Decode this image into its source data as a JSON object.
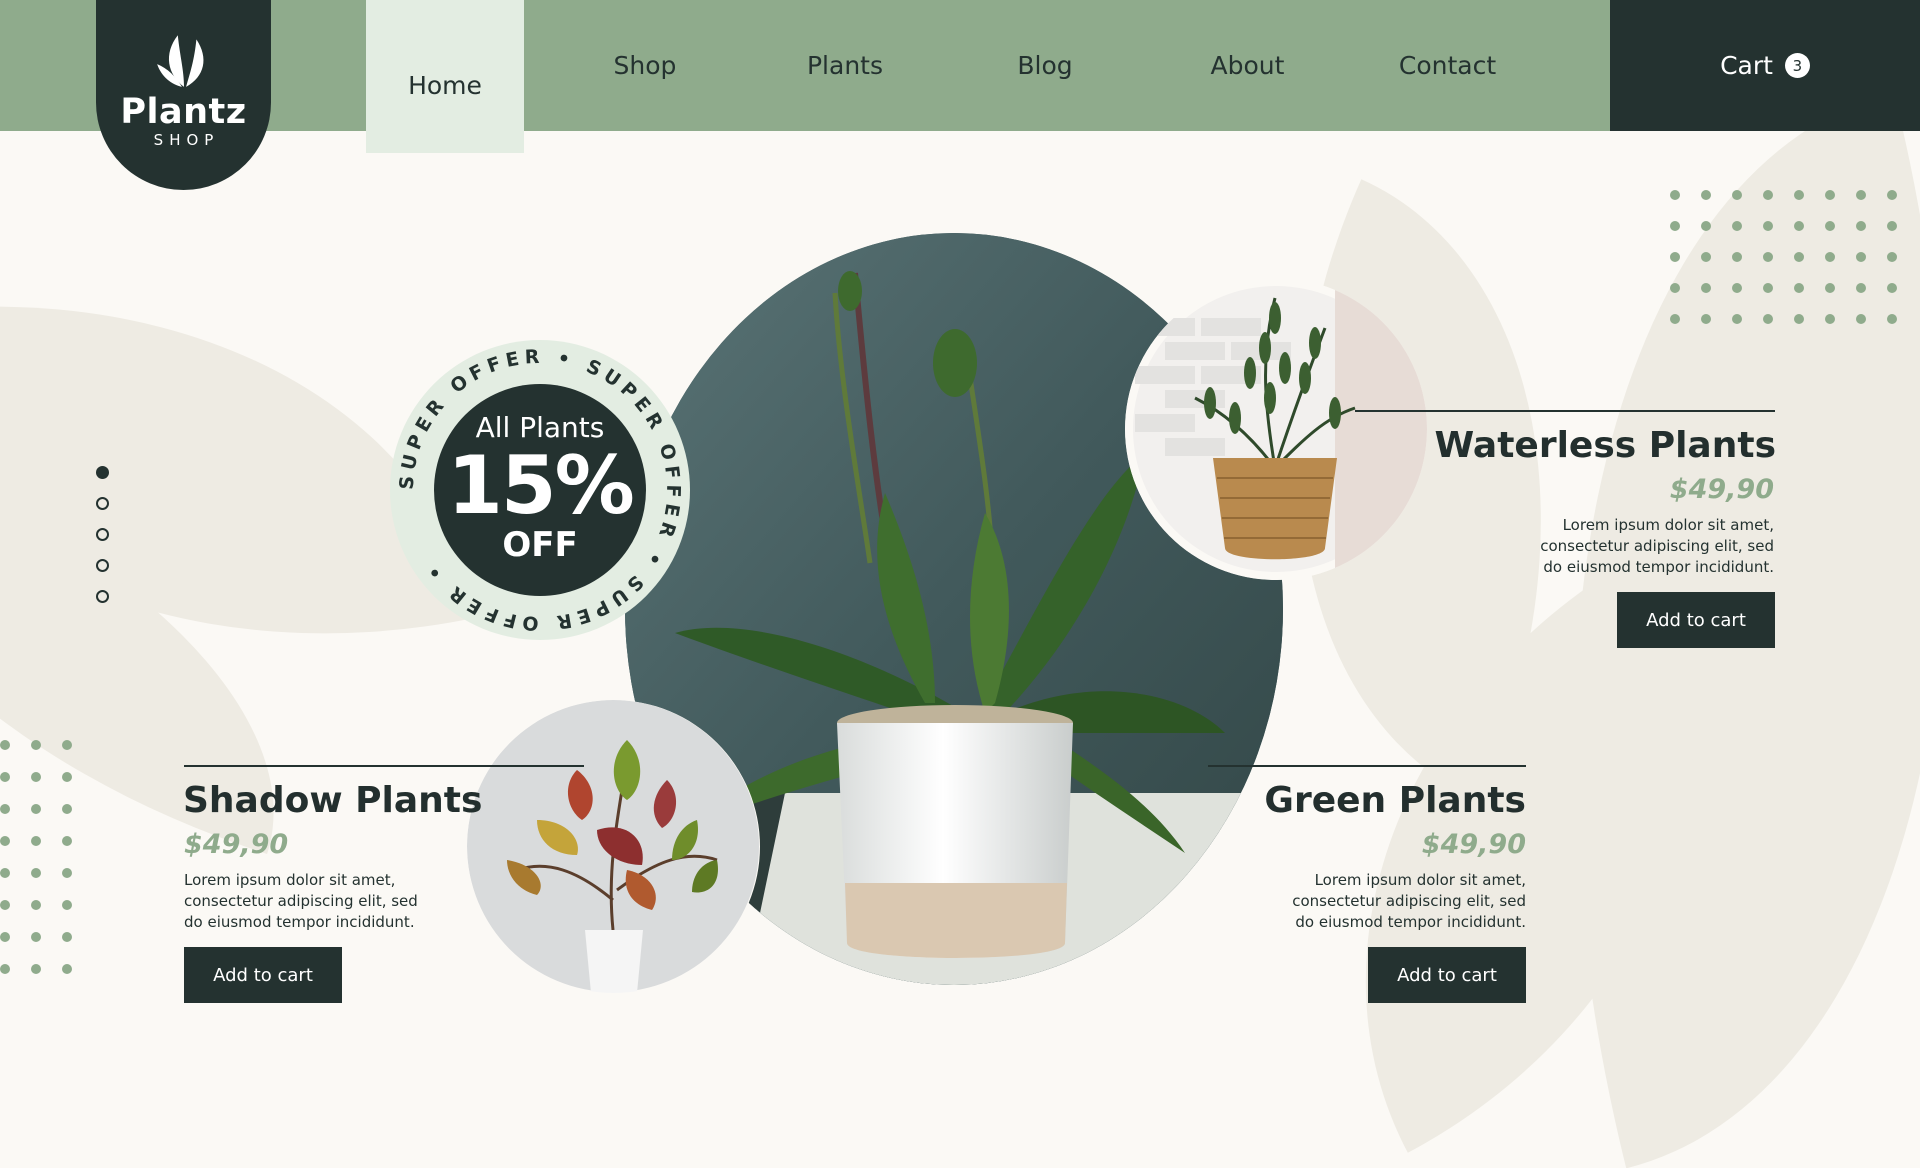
{
  "brand": {
    "name": "Plantz",
    "tagline": "SHOP"
  },
  "nav": {
    "items": [
      "Home",
      "Shop",
      "Plants",
      "Blog",
      "About",
      "Contact"
    ],
    "active": "Home"
  },
  "cart": {
    "label": "Cart",
    "count": "3"
  },
  "offer": {
    "ring_text": "SUPER OFFER • SUPER OFFER • SUPER OFFER •",
    "line1": "All Plants",
    "percent": "15%",
    "suffix": "OFF"
  },
  "slider": {
    "total": 5,
    "active_index": 0
  },
  "products": [
    {
      "title": "Waterless Plants",
      "price": "$49,90",
      "desc": [
        "Lorem ipsum dolor sit amet,",
        "consectetur adipiscing elit, sed",
        "do eiusmod tempor incididunt."
      ],
      "button": "Add to cart"
    },
    {
      "title": "Shadow Plants",
      "price": "$49,90",
      "desc": [
        "Lorem ipsum dolor sit amet,",
        "consectetur adipiscing elit, sed",
        "do eiusmod tempor incididunt."
      ],
      "button": "Add to cart"
    },
    {
      "title": "Green Plants",
      "price": "$49,90",
      "desc": [
        "Lorem ipsum dolor sit amet,",
        "consectetur adipiscing elit, sed",
        "do eiusmod tempor incididunt."
      ],
      "button": "Add to cart"
    }
  ],
  "colors": {
    "primary_dark": "#243230",
    "sage": "#8fab8c",
    "light_sage": "#e3ede2",
    "background": "#fbf9f5",
    "leaf_shape": "#eeebe3"
  },
  "icons": [
    "leaf-logo-icon"
  ]
}
